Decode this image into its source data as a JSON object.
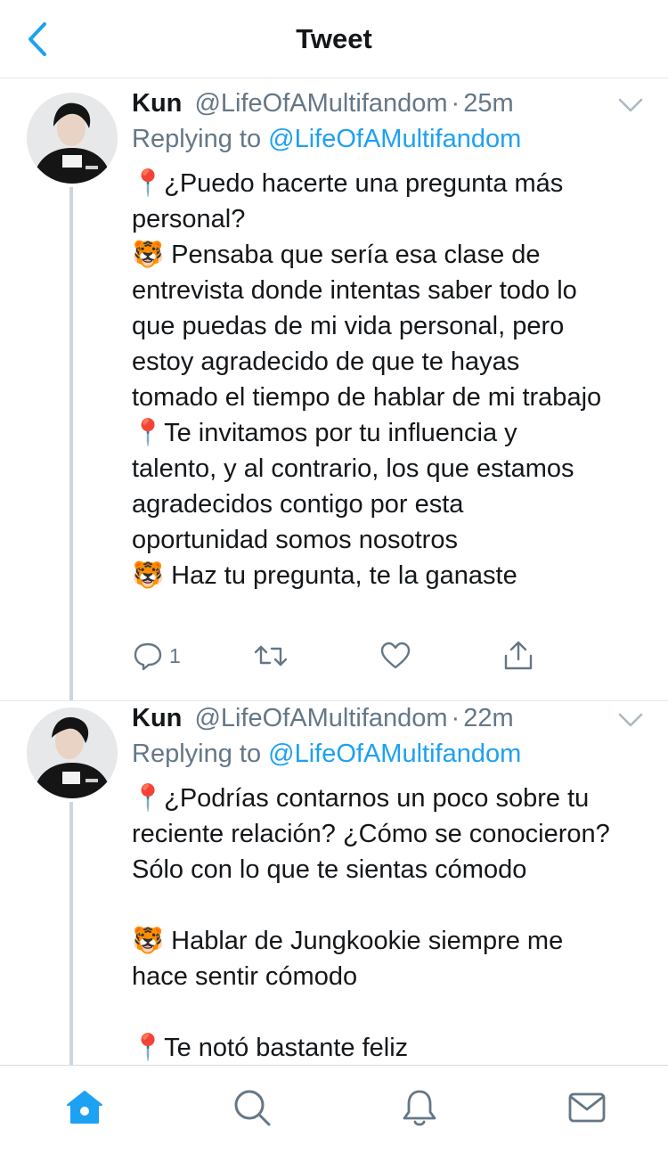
{
  "header": {
    "title": "Tweet",
    "back_icon": "chevron-left-icon"
  },
  "colors": {
    "accent": "#1da1f2",
    "muted": "#657786",
    "text": "#14171a",
    "thread_line": "#cdd6dd",
    "divider": "#e1e8ed"
  },
  "tweets": [
    {
      "author_name": "Kun",
      "author_handle": "@LifeOfAMultifandom",
      "separator": "·",
      "time": "25m",
      "reply_prefix": "Replying to",
      "reply_handle": "@LifeOfAMultifandom",
      "body_lines": [
        "📍¿Puedo hacerte una pregunta más",
        "personal?",
        "🐯 Pensaba que sería esa clase de",
        "entrevista donde intentas saber todo lo",
        "que puedas de mi vida personal, pero",
        "estoy agradecido de que te hayas",
        "tomado el tiempo de hablar de mi trabajo",
        "📍Te invitamos por tu influencia y",
        "talento, y al contrario, los que estamos",
        "agradecidos contigo por esta",
        "oportunidad somos nosotros",
        "🐯 Haz tu pregunta, te la ganaste"
      ],
      "actions": {
        "reply_count": "1",
        "retweet_count": "",
        "like_count": ""
      }
    },
    {
      "author_name": "Kun",
      "author_handle": "@LifeOfAMultifandom",
      "separator": "·",
      "time": "22m",
      "reply_prefix": "Replying to",
      "reply_handle": "@LifeOfAMultifandom",
      "body_lines": [
        "📍¿Podrías contarnos un poco sobre tu",
        "reciente relación? ¿Cómo se conocieron?",
        "Sólo con lo que te sientas cómodo",
        "",
        "🐯 Hablar de Jungkookie siempre me",
        "hace sentir cómodo",
        "",
        "📍Te notó bastante feliz"
      ]
    }
  ],
  "tabbar": {
    "items": [
      "home-icon",
      "search-icon",
      "notifications-icon",
      "messages-icon"
    ],
    "active": "home-icon"
  }
}
